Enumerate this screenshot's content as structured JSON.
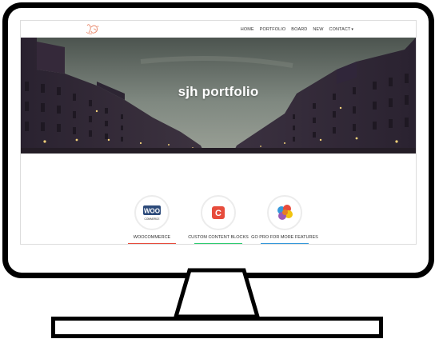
{
  "nav": {
    "items": [
      {
        "label": "HOME"
      },
      {
        "label": "PORTFOLIO"
      },
      {
        "label": "BOARD"
      },
      {
        "label": "NEW"
      },
      {
        "label": "CONTACT"
      }
    ]
  },
  "hero": {
    "title": "sjh portfolio"
  },
  "features": [
    {
      "label": "WOOCOMMERCE",
      "icon": "woocommerce-icon",
      "icon_text": "WOO",
      "icon_subtext": "COMMERCE",
      "bar_color": "#e74c3c"
    },
    {
      "label": "CUSTOM CONTENT BLOCKS",
      "icon": "content-blocks-icon",
      "icon_text": "C",
      "bar_color": "#2ecc71"
    },
    {
      "label": "GO PRO FOR MORE FEATURES",
      "icon": "colorful-badge-icon",
      "bar_color": "#3498db"
    }
  ],
  "colors": {
    "logo": "#e8876a",
    "nav_text": "#333333",
    "hero_text": "#ffffff",
    "c_icon_red": "#e74c3c"
  }
}
